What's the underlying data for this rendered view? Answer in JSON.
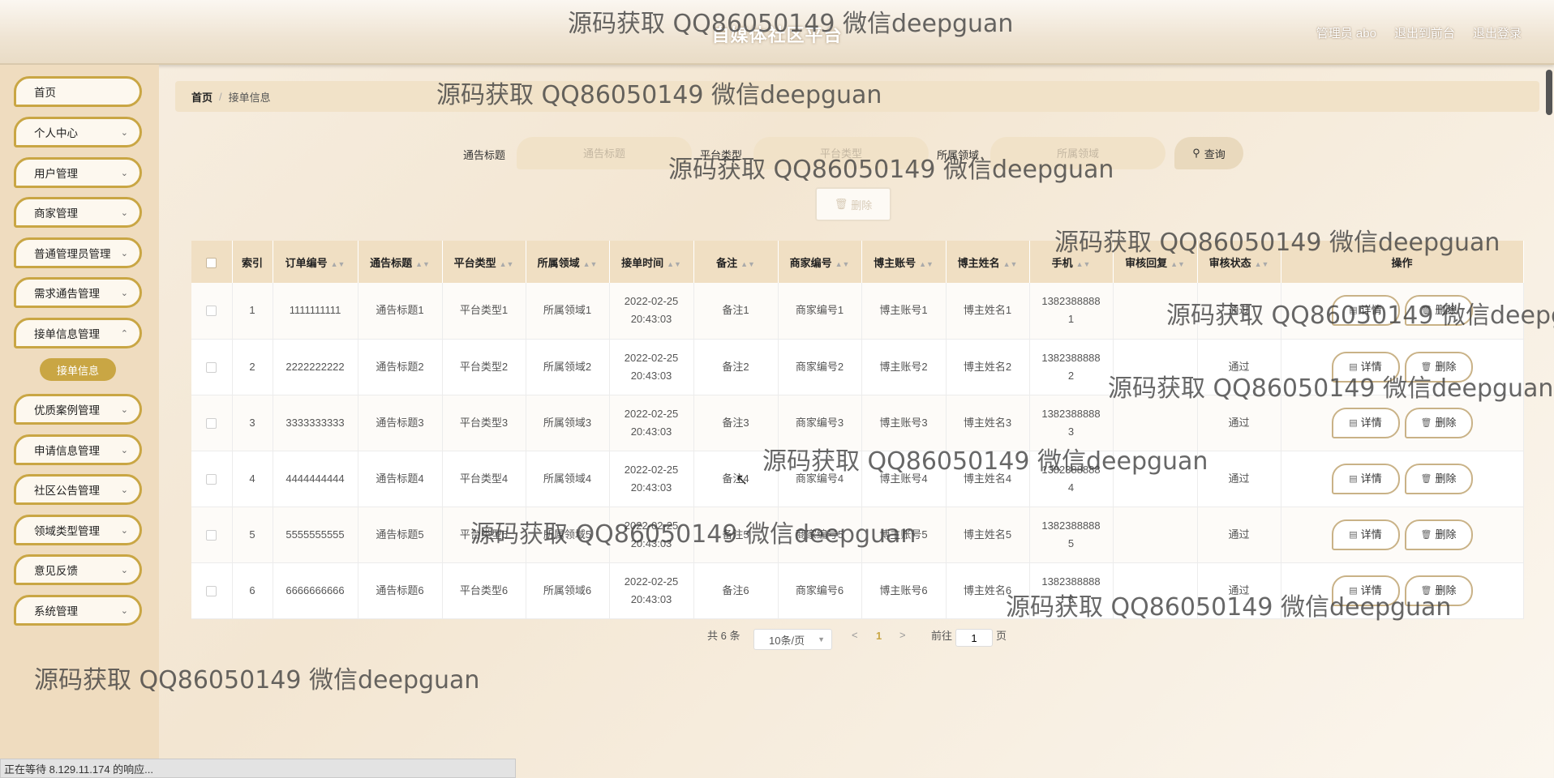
{
  "header": {
    "site_title": "自媒体社区平台",
    "admin_label": "管理员 abo",
    "to_front": "退出到前台",
    "logout": "退出登录"
  },
  "sidebar": {
    "items": [
      {
        "label": "首页"
      },
      {
        "label": "个人中心"
      },
      {
        "label": "用户管理"
      },
      {
        "label": "商家管理"
      },
      {
        "label": "普通管理员管理"
      },
      {
        "label": "需求通告管理"
      },
      {
        "label": "接单信息管理"
      },
      {
        "label": "优质案例管理"
      },
      {
        "label": "申请信息管理"
      },
      {
        "label": "社区公告管理"
      },
      {
        "label": "领域类型管理"
      },
      {
        "label": "意见反馈"
      },
      {
        "label": "系统管理"
      }
    ],
    "sub_active": "接单信息"
  },
  "breadcrumb": {
    "home": "首页",
    "sep": "/",
    "current": "接单信息"
  },
  "search": {
    "title_label": "通告标题",
    "title_placeholder": "通告标题",
    "platform_label": "平台类型",
    "platform_placeholder": "平台类型",
    "domain_label": "所属领域",
    "domain_placeholder": "所属领域",
    "query_label": "查询",
    "delete_label": "删除"
  },
  "table": {
    "headers": [
      "索引",
      "订单编号",
      "通告标题",
      "平台类型",
      "所属领域",
      "接单时间",
      "备注",
      "商家编号",
      "博主账号",
      "博主姓名",
      "手机",
      "审核回复",
      "审核状态",
      "操作"
    ],
    "rows": [
      {
        "idx": "1",
        "order": "1111111111",
        "title": "通告标题1",
        "platform": "平台类型1",
        "domain": "所属领域1",
        "date": "2022-02-25",
        "time": "20:43:03",
        "note": "备注1",
        "merchant": "商家编号1",
        "account": "博主账号1",
        "name": "博主姓名1",
        "phone1": "1382388888",
        "phone2": "1",
        "reply": "",
        "status": "通过"
      },
      {
        "idx": "2",
        "order": "2222222222",
        "title": "通告标题2",
        "platform": "平台类型2",
        "domain": "所属领域2",
        "date": "2022-02-25",
        "time": "20:43:03",
        "note": "备注2",
        "merchant": "商家编号2",
        "account": "博主账号2",
        "name": "博主姓名2",
        "phone1": "1382388888",
        "phone2": "2",
        "reply": "",
        "status": "通过"
      },
      {
        "idx": "3",
        "order": "3333333333",
        "title": "通告标题3",
        "platform": "平台类型3",
        "domain": "所属领域3",
        "date": "2022-02-25",
        "time": "20:43:03",
        "note": "备注3",
        "merchant": "商家编号3",
        "account": "博主账号3",
        "name": "博主姓名3",
        "phone1": "1382388888",
        "phone2": "3",
        "reply": "",
        "status": "通过"
      },
      {
        "idx": "4",
        "order": "4444444444",
        "title": "通告标题4",
        "platform": "平台类型4",
        "domain": "所属领域4",
        "date": "2022-02-25",
        "time": "20:43:03",
        "note": "备注4",
        "merchant": "商家编号4",
        "account": "博主账号4",
        "name": "博主姓名4",
        "phone1": "1382388888",
        "phone2": "4",
        "reply": "",
        "status": "通过"
      },
      {
        "idx": "5",
        "order": "5555555555",
        "title": "通告标题5",
        "platform": "平台类型5",
        "domain": "所属领域5",
        "date": "2022-02-25",
        "time": "20:43:03",
        "note": "备注5",
        "merchant": "商家编号5",
        "account": "博主账号5",
        "name": "博主姓名5",
        "phone1": "1382388888",
        "phone2": "5",
        "reply": "",
        "status": "通过"
      },
      {
        "idx": "6",
        "order": "6666666666",
        "title": "通告标题6",
        "platform": "平台类型6",
        "domain": "所属领域6",
        "date": "2022-02-25",
        "time": "20:43:03",
        "note": "备注6",
        "merchant": "商家编号6",
        "account": "博主账号6",
        "name": "博主姓名6",
        "phone1": "1382388888",
        "phone2": "6",
        "reply": "",
        "status": "通过"
      }
    ],
    "detail_label": "详情",
    "delete_label": "删除"
  },
  "pagination": {
    "total": "共 6 条",
    "page_size": "10条/页",
    "prev": "<",
    "current": "1",
    "next": ">",
    "goto_label": "前往",
    "goto_value": "1",
    "page_suffix": "页"
  },
  "watermark": "源码获取 QQ86050149 微信deepguan",
  "statusbar": "正在等待 8.129.11.174 的响应...",
  "colors": {
    "accent": "#c9a644",
    "header_bg": "#f0dfc3",
    "sidebar_bg": "#efdcbf"
  }
}
